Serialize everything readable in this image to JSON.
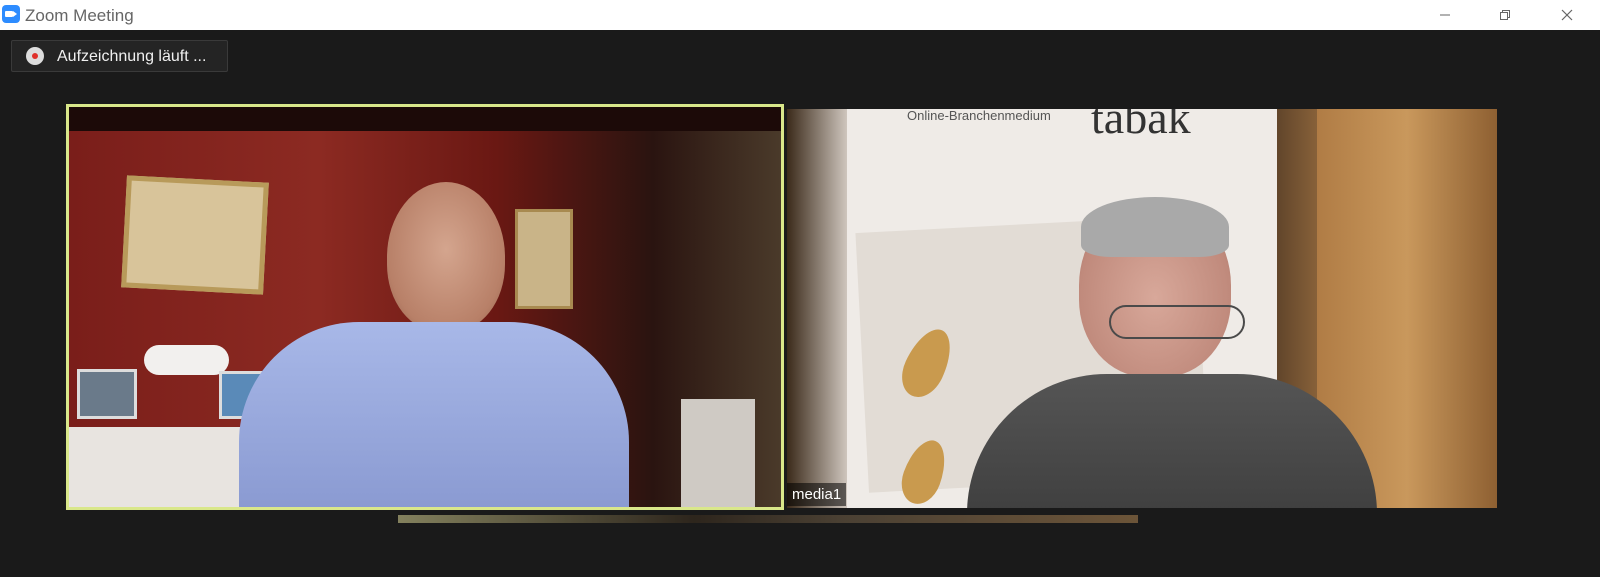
{
  "window": {
    "title": "Zoom Meeting",
    "app_icon": "zoom-camera-icon"
  },
  "window_controls": {
    "minimize_icon": "minimize-icon",
    "maximize_icon": "restore-icon",
    "close_icon": "close-icon"
  },
  "recording": {
    "label": "Aufzeichnung läuft ...",
    "icon": "record-icon"
  },
  "video_tiles": [
    {
      "participant_name": "",
      "active_speaker": true
    },
    {
      "participant_name": "media1",
      "active_speaker": false
    }
  ],
  "banner": {
    "headline": "tabak",
    "subheadline": "Online-Branchenmedium"
  },
  "colors": {
    "active_speaker_border": "#d9e78a",
    "app_brand": "#2d8cff",
    "record_red": "#e0302a"
  }
}
